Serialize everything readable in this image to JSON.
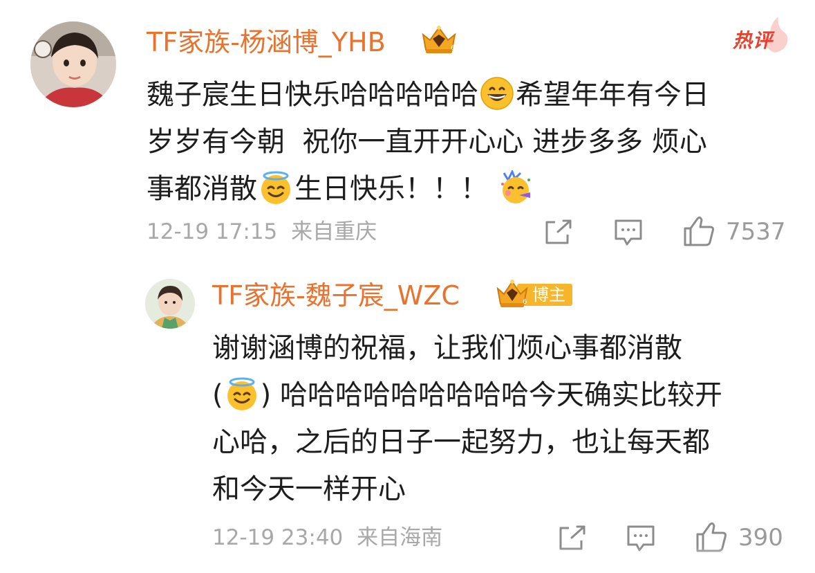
{
  "comment": {
    "username": "TF家族-杨涵博_YHB",
    "hot_label": "热评",
    "text_lines": [
      [
        "魏子宸生日快乐哈哈哈哈哈",
        "grin-emoji",
        "希望年年有今日"
      ],
      [
        "岁岁有今朝  祝你一直开开心心 进步多多 烦心"
      ],
      [
        "事都消散",
        "halo-emoji",
        "生日快乐！！！ ",
        "party-emoji"
      ]
    ],
    "timestamp": "12-19 17:15",
    "location": "来自重庆",
    "like_count": "7537"
  },
  "reply": {
    "username": "TF家族-魏子宸_WZC",
    "badge": "博主",
    "text_lines": [
      [
        "谢谢涵博的祝福，让我们烦心事都消散"
      ],
      [
        "(",
        "halo-emoji",
        ") 哈哈哈哈哈哈哈哈哈今天确实比较开"
      ],
      [
        "心哈，之后的日子一起努力，也让每天都"
      ],
      [
        "和今天一样开心"
      ]
    ],
    "timestamp": "12-19 23:40",
    "location": "来自海南",
    "like_count": "390"
  },
  "colors": {
    "username": "#e8722e",
    "hot": "#e8412f",
    "meta": "#a8a8a8",
    "badge": "#f7b52b"
  },
  "icons": [
    "share-icon",
    "comment-icon",
    "like-icon",
    "crown-badge-icon",
    "avatar"
  ]
}
